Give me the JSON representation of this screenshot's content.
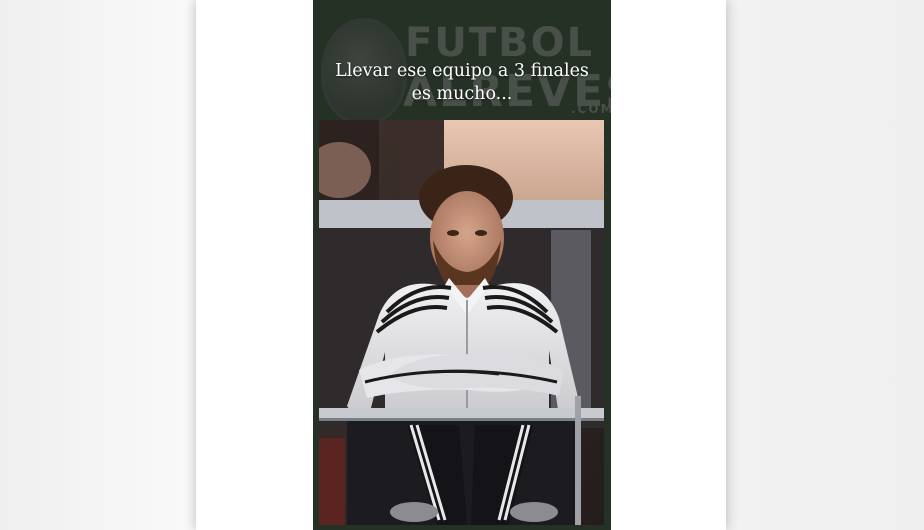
{
  "caption": {
    "line1": "Llevar ese equipo a 3 finales",
    "line2": "es mucho..."
  },
  "watermark": {
    "word_top": "FUTBOL",
    "word_bottom": "ALREVES",
    "domain": ".COM",
    "icon": "mascot-logo"
  },
  "photo": {
    "subject": "man in white track jacket with black stripes seated behind railing"
  },
  "colors": {
    "card_bg": "#263126",
    "caption_text": "#ffffff",
    "jacket": "#e8e8ea",
    "stripes": "#1a1a1a"
  }
}
